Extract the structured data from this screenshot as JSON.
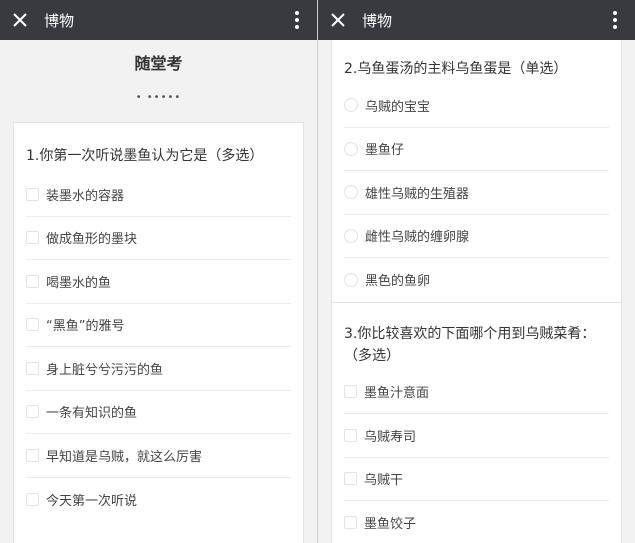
{
  "left": {
    "nav": {
      "title": "博物"
    },
    "page": {
      "title": "随堂考",
      "subtitle": "•  •••••"
    },
    "q1": {
      "title": "1.你第一次听说墨鱼认为它是（多选）",
      "options": [
        "装墨水的容器",
        "做成鱼形的墨块",
        "喝墨水的鱼",
        "“黑鱼”的雅号",
        "身上脏兮兮污污的鱼",
        "一条有知识的鱼",
        "早知道是乌贼，就这么厉害",
        "今天第一次听说"
      ]
    }
  },
  "right": {
    "nav": {
      "title": "博物"
    },
    "q2": {
      "title": "2.乌鱼蛋汤的主料乌鱼蛋是（单选）",
      "options": [
        "乌贼的宝宝",
        "墨鱼仔",
        "雄性乌贼的生殖器",
        "雌性乌贼的缠卵腺",
        "黑色的鱼卵"
      ]
    },
    "q3": {
      "title": "3.你比较喜欢的下面哪个用到乌贼菜肴：（多选）",
      "options": [
        "墨鱼汁意面",
        "乌贼寿司",
        "乌贼干",
        "墨鱼饺子"
      ]
    }
  }
}
